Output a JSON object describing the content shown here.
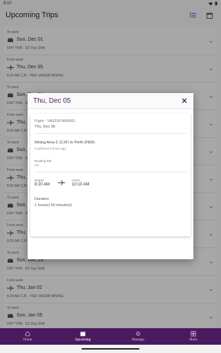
{
  "status_bar": {
    "time": "8:10"
  },
  "app_bar": {
    "title": "Upcoming Trips",
    "list_icon": "list-icon",
    "calendar_icon": "calendar-icon"
  },
  "trips": [
    {
      "direction": "To work",
      "mode": "car",
      "date": "Sun, Dec 01",
      "sub": "DRY YNN · D2 Day Shift"
    },
    {
      "direction": "From work",
      "mode": "plane",
      "date": "Thu, Dec 05",
      "sub": "8:20 AM CJF · PER VA9338 MINING"
    },
    {
      "direction": "To work",
      "mode": "car",
      "date": "Sun, Dec 08",
      "sub": "DRY YNN · D2 Day Shift"
    },
    {
      "direction": "From work",
      "mode": "plane",
      "date": "Thu, Dec 12",
      "sub": "8:20 AM CJF · PER VA9338 MINING"
    },
    {
      "direction": "To work",
      "mode": "car",
      "date": "Sun, Dec 15",
      "sub": "DRY YNN · D2 Day Shift"
    },
    {
      "direction": "From work",
      "mode": "plane",
      "date": "Thu, Dec 19",
      "sub": "8:20 AM CJF · PER VA9338 MINING"
    },
    {
      "direction": "To work",
      "mode": "car",
      "date": "Sun, Dec 22",
      "sub": "DRY YNN · D2 Day Shift"
    },
    {
      "direction": "From work",
      "mode": "plane",
      "date": "Thu, Dec 26",
      "sub": "8:20 AM CJF · PER VA9338 MINING"
    },
    {
      "direction": "To work",
      "mode": "car",
      "date": "Sun, Dec 29",
      "sub": "DRY YNN · D2 Day Shift"
    },
    {
      "direction": "From work",
      "mode": "plane",
      "date": "Thu, Jan 02",
      "sub": "8:20 AM CJF · PER VA9338 MINING"
    },
    {
      "direction": "To work",
      "mode": "car",
      "date": "Sun, Jan 05",
      "sub": "DRY YNN · D2 Day Shift"
    }
  ],
  "dialog": {
    "title": "Thu, Dec 05",
    "flight": "Flight - VA9338 MINING",
    "date": "Thu, Dec 05",
    "route": "Mining Area C (CJF) to Perth (PER)",
    "confirmed": "Confirmed 3 hours ago",
    "booking_ref_label": "Booking Ref",
    "booking_ref_value": "—",
    "depart_label": "Depart",
    "depart_time": "8:20 AM",
    "arrive_label": "Arrive",
    "arrive_time": "10:10 AM",
    "duration_label": "Duration",
    "duration_value": "1 hour(s) 50 minute(s)"
  },
  "bottom_nav": [
    {
      "label": "Home",
      "icon": "home-icon",
      "active": false
    },
    {
      "label": "Upcoming",
      "icon": "calendar-icon",
      "active": true
    },
    {
      "label": "Manage",
      "icon": "gear-icon",
      "active": false
    },
    {
      "label": "More",
      "icon": "grid-icon",
      "active": false
    }
  ],
  "colors": {
    "brand": "#4a1a5e",
    "accent": "#5b4bd6"
  }
}
